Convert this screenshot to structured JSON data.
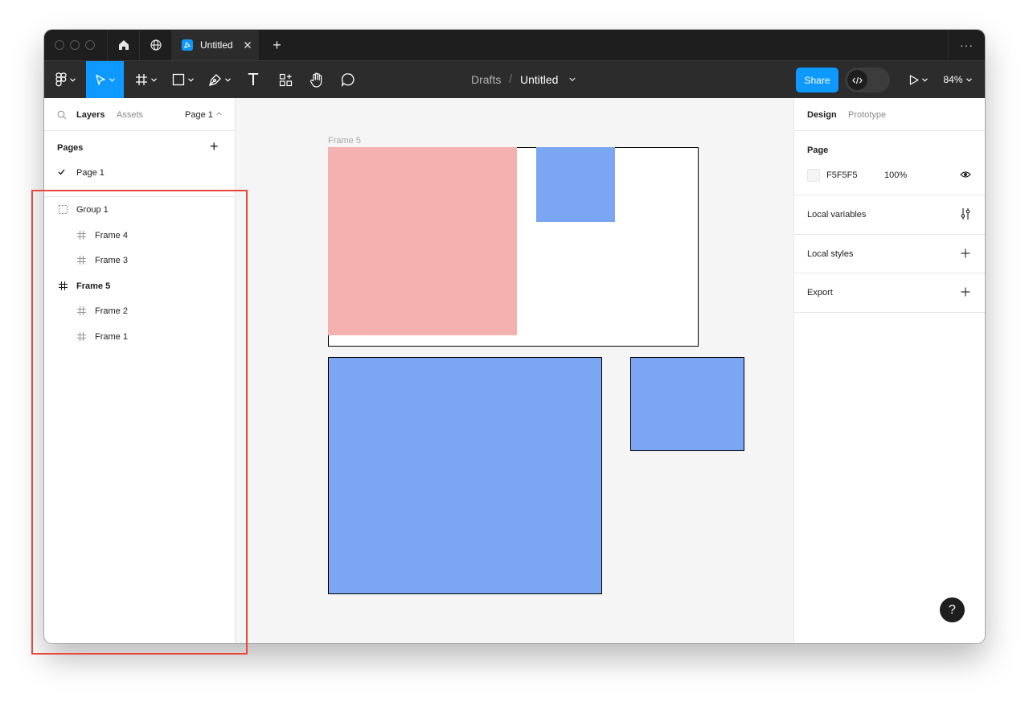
{
  "titlebar": {
    "tab_title": "Untitled",
    "new_tab_label": "+",
    "more_label": "···"
  },
  "toolbar": {
    "breadcrumb_parent": "Drafts",
    "breadcrumb_separator": "/",
    "file_name": "Untitled",
    "share_label": "Share",
    "zoom": "84%",
    "text_tool_label": "T"
  },
  "left_panel": {
    "tabs": [
      "Layers",
      "Assets"
    ],
    "page_selector": "Page 1",
    "pages_heading": "Pages",
    "add_page_label": "+",
    "pages": [
      {
        "label": "Page 1",
        "current": true
      }
    ],
    "layers": [
      {
        "label": "Group 1",
        "type": "group",
        "indent": 0,
        "bold": false
      },
      {
        "label": "Frame 4",
        "type": "frame",
        "indent": 1,
        "bold": false
      },
      {
        "label": "Frame 3",
        "type": "frame",
        "indent": 1,
        "bold": false
      },
      {
        "label": "Frame 5",
        "type": "frame",
        "indent": 0,
        "bold": true
      },
      {
        "label": "Frame 2",
        "type": "frame",
        "indent": 1,
        "bold": false
      },
      {
        "label": "Frame 1",
        "type": "frame",
        "indent": 1,
        "bold": false
      }
    ]
  },
  "canvas": {
    "frame_label": "Frame 5",
    "background": "#F5F5F5",
    "colors": {
      "pink": "#F4B1AF",
      "blue": "#7BA6F4",
      "frame": "#FFFFFF"
    }
  },
  "right_panel": {
    "tabs": [
      "Design",
      "Prototype"
    ],
    "page_heading": "Page",
    "page_color": "F5F5F5",
    "page_opacity": "100%",
    "sections": [
      {
        "label": "Local variables",
        "icon": "sliders-icon"
      },
      {
        "label": "Local styles",
        "icon": "plus-icon"
      },
      {
        "label": "Export",
        "icon": "plus-icon"
      }
    ]
  },
  "help_label": "?",
  "colors": {
    "accent": "#0D99FF",
    "highlight": "#E8473B",
    "toolbar": "#2C2C2C",
    "titlebar": "#1E1E1E"
  }
}
